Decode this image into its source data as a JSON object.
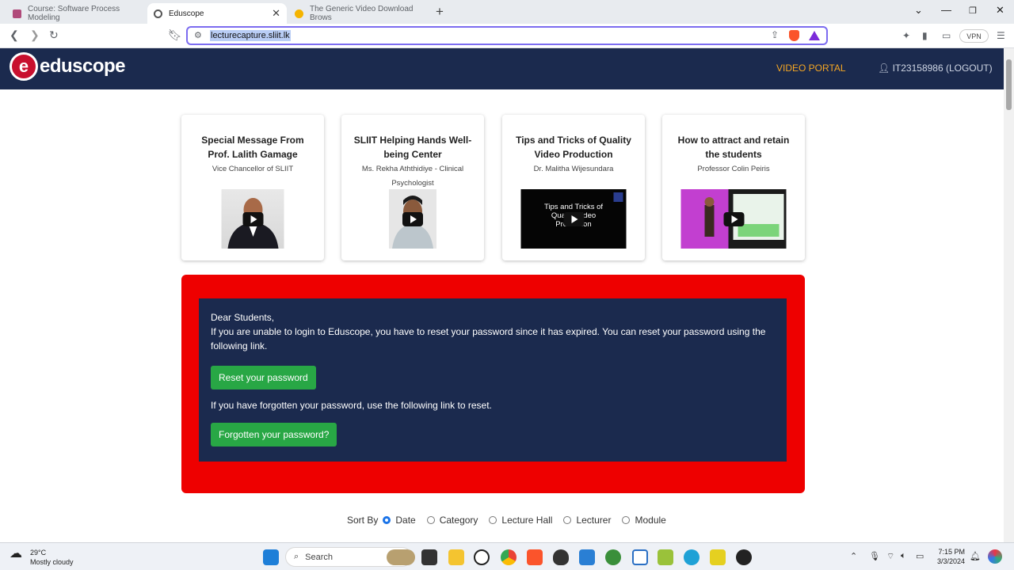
{
  "browser": {
    "tabs": [
      {
        "label": "Course: Software Process Modeling",
        "active": false
      },
      {
        "label": "Eduscope",
        "active": true
      },
      {
        "label": "The Generic Video Download Brows",
        "active": false
      }
    ],
    "url": "lecturecapture.sliit.lk",
    "vpn_label": "VPN"
  },
  "site": {
    "logo_letter": "e",
    "logo_text": "eduscope",
    "nav_portal": "VIDEO PORTAL",
    "nav_user": "IT23158986 (LOGOUT)",
    "brand_color": "#1b2a4e",
    "accent_color": "#f5a623"
  },
  "cards": [
    {
      "title": "Special Message From Prof. Lalith Gamage",
      "subtitle": "Vice Chancellor of SLIIT"
    },
    {
      "title": "SLIIT Helping Hands Well-being Center",
      "subtitle": "Ms. Rekha Aththidiye - Clinical Psychologist"
    },
    {
      "title": "Tips and Tricks of Quality Video Production",
      "subtitle": "Dr. Malitha Wijesundara",
      "thumb_text": "Tips and Tricks of Quality Video Production"
    },
    {
      "title": "How to attract and retain the students",
      "subtitle": "Professor Colin Peiris"
    }
  ],
  "alert": {
    "greeting": "Dear Students,",
    "message": "If you are unable to login to Eduscope, you have to reset your password since it has expired. You can reset your password using the following link.",
    "reset_button": "Reset your password",
    "forgot_text": "If you have forgotten your password, use the following link to reset.",
    "forgot_button": "Forgotten your password?"
  },
  "sort": {
    "label": "Sort By",
    "options": [
      "Date",
      "Category",
      "Lecture Hall",
      "Lecturer",
      "Module"
    ],
    "selected": "Date"
  },
  "taskbar": {
    "temperature": "29°C",
    "weather": "Mostly cloudy",
    "search_placeholder": "Search",
    "time": "7:15 PM",
    "date": "3/3/2024"
  }
}
